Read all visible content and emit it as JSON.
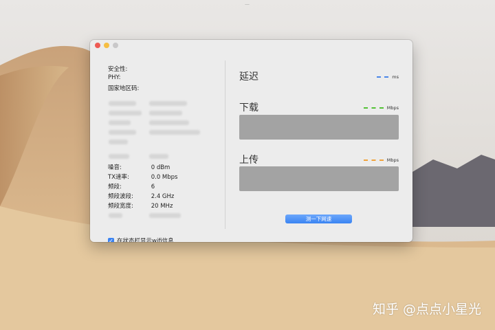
{
  "watermark_top": "—",
  "watermark": "知乎 @点点小星光",
  "left": {
    "security_label": "安全性:",
    "phy_label": "PHY:",
    "country_label": "国家地区码:",
    "noise_label": "噪音:",
    "noise_value": "0 dBm",
    "tx_label": "TX速率:",
    "tx_value": "0.0 Mbps",
    "channel_label": "频段:",
    "channel_value": "6",
    "band_label": "频段波段:",
    "band_value": "2.4 GHz",
    "width_label": "频段宽度:",
    "width_value": "20 MHz",
    "show_in_menubar_label": "在状态栏显示wifi信息",
    "show_in_menubar_checked": true
  },
  "right": {
    "latency_title": "延迟",
    "latency_unit": "ms",
    "download_title": "下载",
    "download_unit": "Mbps",
    "upload_title": "上传",
    "upload_unit": "Mbps",
    "test_button_label": "测一下网速"
  },
  "colors": {
    "latency_series": "#4a86e8",
    "download_series": "#52c234",
    "upload_series": "#f0a23a",
    "button": "#3a84f2"
  }
}
